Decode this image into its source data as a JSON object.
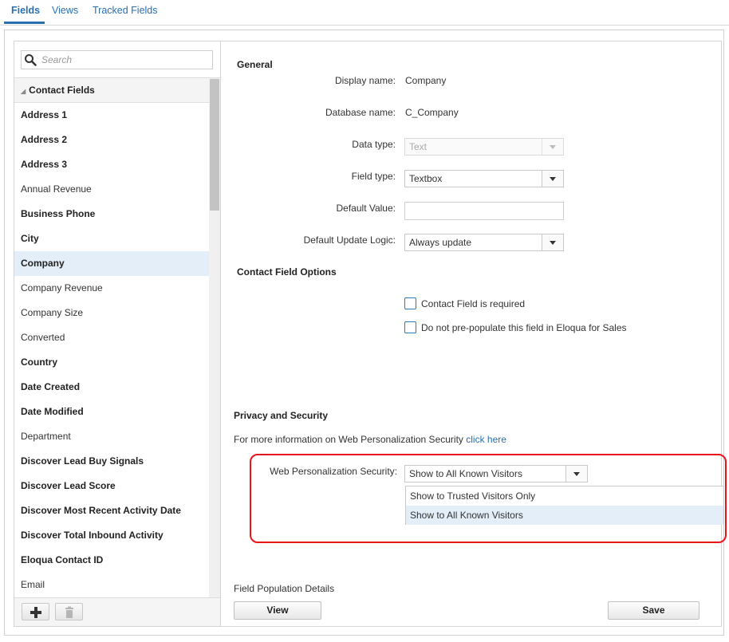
{
  "tabs": [
    {
      "label": "Fields",
      "active": true
    },
    {
      "label": "Views",
      "active": false
    },
    {
      "label": "Tracked Fields",
      "active": false
    }
  ],
  "sidebar": {
    "search_placeholder": "Search",
    "group_label": "Contact Fields",
    "items": [
      {
        "label": "Address 1",
        "bold": true
      },
      {
        "label": "Address 2",
        "bold": true
      },
      {
        "label": "Address 3",
        "bold": true
      },
      {
        "label": "Annual Revenue",
        "bold": false
      },
      {
        "label": "Business Phone",
        "bold": true
      },
      {
        "label": "City",
        "bold": true
      },
      {
        "label": "Company",
        "bold": true,
        "selected": true
      },
      {
        "label": "Company Revenue",
        "bold": false
      },
      {
        "label": "Company Size",
        "bold": false
      },
      {
        "label": "Converted",
        "bold": false
      },
      {
        "label": "Country",
        "bold": true
      },
      {
        "label": "Date Created",
        "bold": true
      },
      {
        "label": "Date Modified",
        "bold": true
      },
      {
        "label": "Department",
        "bold": false
      },
      {
        "label": "Discover Lead Buy Signals",
        "bold": true
      },
      {
        "label": "Discover Lead Score",
        "bold": true
      },
      {
        "label": "Discover Most Recent Activity Date",
        "bold": true
      },
      {
        "label": "Discover Total Inbound Activity",
        "bold": true
      },
      {
        "label": "Eloqua Contact ID",
        "bold": true
      },
      {
        "label": "Email",
        "bold": false
      }
    ],
    "add_icon": "plus-icon",
    "delete_icon": "trash-icon"
  },
  "general": {
    "title": "General",
    "display_name_label": "Display name:",
    "display_name_value": "Company",
    "database_name_label": "Database name:",
    "database_name_value": "C_Company",
    "data_type_label": "Data type:",
    "data_type_value": "Text",
    "field_type_label": "Field type:",
    "field_type_value": "Textbox",
    "default_value_label": "Default Value:",
    "default_value_value": "",
    "default_update_label": "Default Update Logic:",
    "default_update_value": "Always update"
  },
  "contact_options": {
    "title": "Contact Field Options",
    "required_label": "Contact Field is required",
    "prepopulate_label": "Do not pre-populate this field in Eloqua for Sales"
  },
  "privacy": {
    "title": "Privacy and Security",
    "info_text": "For more information on Web Personalization Security",
    "info_link": "click here",
    "wps_label": "Web Personalization Security:",
    "wps_value": "Show to All Known Visitors",
    "options": [
      {
        "label": "Show to Trusted Visitors Only",
        "highlighted": false
      },
      {
        "label": "Show to All Known Visitors",
        "highlighted": true
      }
    ],
    "highlight_color": "#e8141c"
  },
  "population": {
    "title": "Field Population Details",
    "view_label": "View",
    "save_label": "Save"
  }
}
